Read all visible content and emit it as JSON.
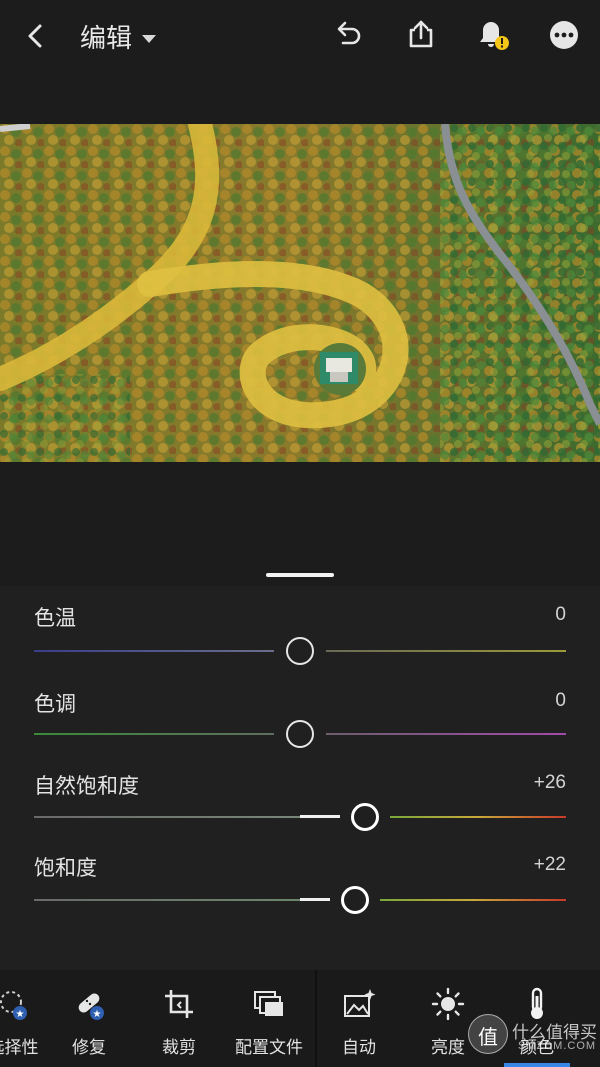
{
  "header": {
    "title": "编辑"
  },
  "sliders": [
    {
      "label": "色温",
      "value": "0",
      "position": 0.5
    },
    {
      "label": "色调",
      "value": "0",
      "position": 0.5
    },
    {
      "label": "自然饱和度",
      "value": "+26",
      "position": 0.63
    },
    {
      "label": "饱和度",
      "value": "+22",
      "position": 0.61
    }
  ],
  "toolbar": {
    "tools": [
      {
        "label": "选择性",
        "icon": "selective-icon"
      },
      {
        "label": "修复",
        "icon": "healing-icon"
      },
      {
        "label": "裁剪",
        "icon": "crop-icon"
      },
      {
        "label": "配置文件",
        "icon": "profiles-icon"
      },
      {
        "label": "自动",
        "icon": "auto-icon"
      },
      {
        "label": "亮度",
        "icon": "light-icon"
      },
      {
        "label": "颜色",
        "icon": "color-thermometer-icon"
      }
    ],
    "selected": "颜色"
  },
  "watermark": {
    "badge": "值",
    "line1": "什么值得买",
    "line2": "SMZDM.COM"
  },
  "colors": {
    "background": "#1c1c1c",
    "panel": "#202020",
    "accent": "#3a86e8",
    "warning_badge": "#f5c518"
  }
}
